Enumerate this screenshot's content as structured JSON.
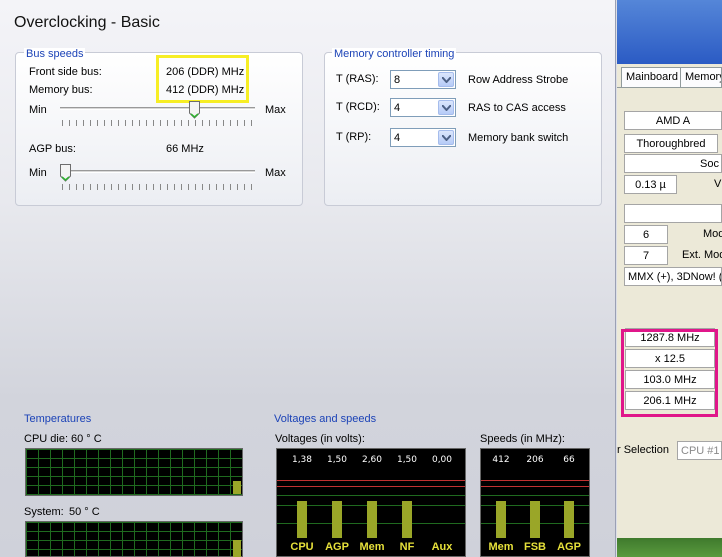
{
  "panel": {
    "title": "Overclocking - Basic",
    "bus_speeds": {
      "title": "Bus speeds",
      "fsb_label": "Front side bus:",
      "fsb_value": "206 (DDR) MHz",
      "mem_label": "Memory bus:",
      "mem_value": "412 (DDR) MHz",
      "min": "Min",
      "max": "Max",
      "bus_slider_fraction": 0.7,
      "agp_label": "AGP bus:",
      "agp_value": "66 MHz",
      "agp_slider_fraction": 0.0
    },
    "memory_timing": {
      "title": "Memory controller timing",
      "rows": [
        {
          "label": "T (RAS):",
          "value": "8",
          "desc": "Row Address Strobe"
        },
        {
          "label": "T (RCD):",
          "value": "4",
          "desc": "RAS to CAS access"
        },
        {
          "label": "T (RP):",
          "value": "4",
          "desc": "Memory bank switch"
        }
      ]
    },
    "temperatures": {
      "title": "Temperatures",
      "cpu_label": "CPU die:",
      "cpu_value": "60 ° C",
      "sys_label": "System:",
      "sys_value": "50 ° C"
    },
    "voltages_speeds": {
      "title": "Voltages and speeds",
      "volt_label": "Voltages (in volts):",
      "volts": [
        {
          "name": "CPU",
          "value": "1,38",
          "level": 0.38
        },
        {
          "name": "AGP",
          "value": "1,50",
          "level": 0.38
        },
        {
          "name": "Mem",
          "value": "2,60",
          "level": 0.38
        },
        {
          "name": "NF",
          "value": "1,50",
          "level": 0.38
        },
        {
          "name": "Aux",
          "value": "0,00",
          "level": 0.0
        }
      ],
      "speed_label": "Speeds (in MHz):",
      "speeds": [
        {
          "name": "Mem",
          "value": "412",
          "level": 0.38
        },
        {
          "name": "FSB",
          "value": "206",
          "level": 0.38
        },
        {
          "name": "AGP",
          "value": "66",
          "level": 0.38
        }
      ]
    }
  },
  "background_app": {
    "tabs": [
      "Mainboard",
      "Memory"
    ],
    "fields": [
      "AMD A",
      "Thoroughbred",
      "Soc",
      "0.13 µ",
      "V",
      "6",
      "Mod",
      "7",
      "Ext. Mod",
      "MMX (+), 3DNow! (+"
    ],
    "clocks": [
      "1287.8 MHz",
      "x 12.5",
      "103.0 MHz",
      "206.1 MHz"
    ],
    "selection_label": "r Selection",
    "selection_value": "CPU #1"
  },
  "colors": {
    "section_title": "#1c43b7",
    "highlight_yellow": "#f7ee25",
    "highlight_pink": "#e0168a",
    "bar_green": "#9aa628"
  }
}
